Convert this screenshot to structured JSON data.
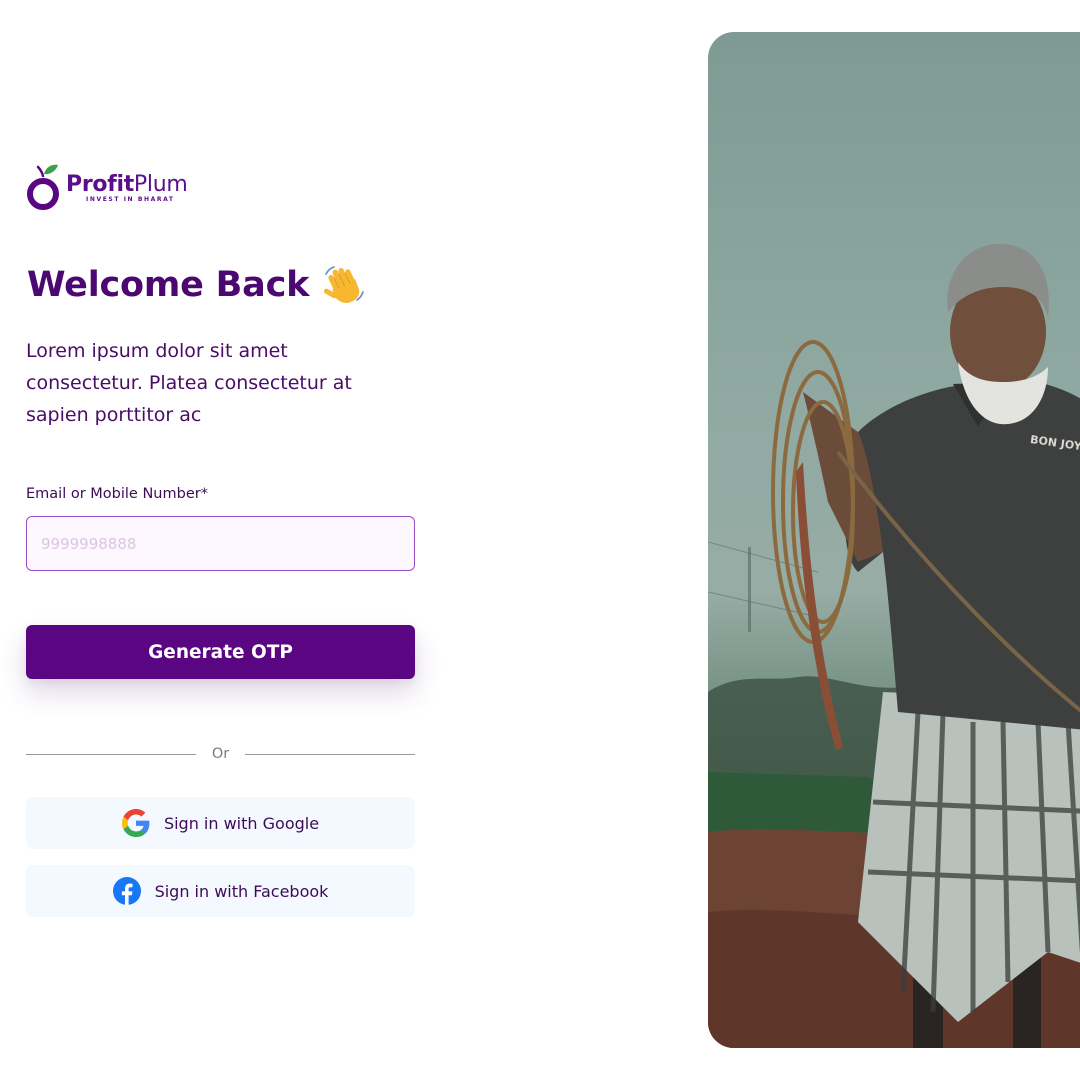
{
  "brand": {
    "name_bold": "Profit",
    "name_light": "Plum",
    "tagline": "INVEST IN BHARAT",
    "colors": {
      "primary": "#5a0683",
      "leaf": "#3aa14a"
    }
  },
  "welcome": {
    "title": "Welcome Back",
    "emoji_icon": "waving-hand-icon",
    "description": "Lorem ipsum dolor sit amet consectetur. Platea consectetur at sapien porttitor ac"
  },
  "form": {
    "label": "Email or Mobile Number*",
    "placeholder": "9999998888",
    "value": "",
    "submit_label": "Generate OTP"
  },
  "divider": {
    "label": "Or"
  },
  "social": {
    "google_label": "Sign in with Google",
    "facebook_label": "Sign in with Facebook"
  },
  "hero_image": {
    "subject": "farmer-with-rope-photo",
    "shirt_text": "BON JOY"
  }
}
